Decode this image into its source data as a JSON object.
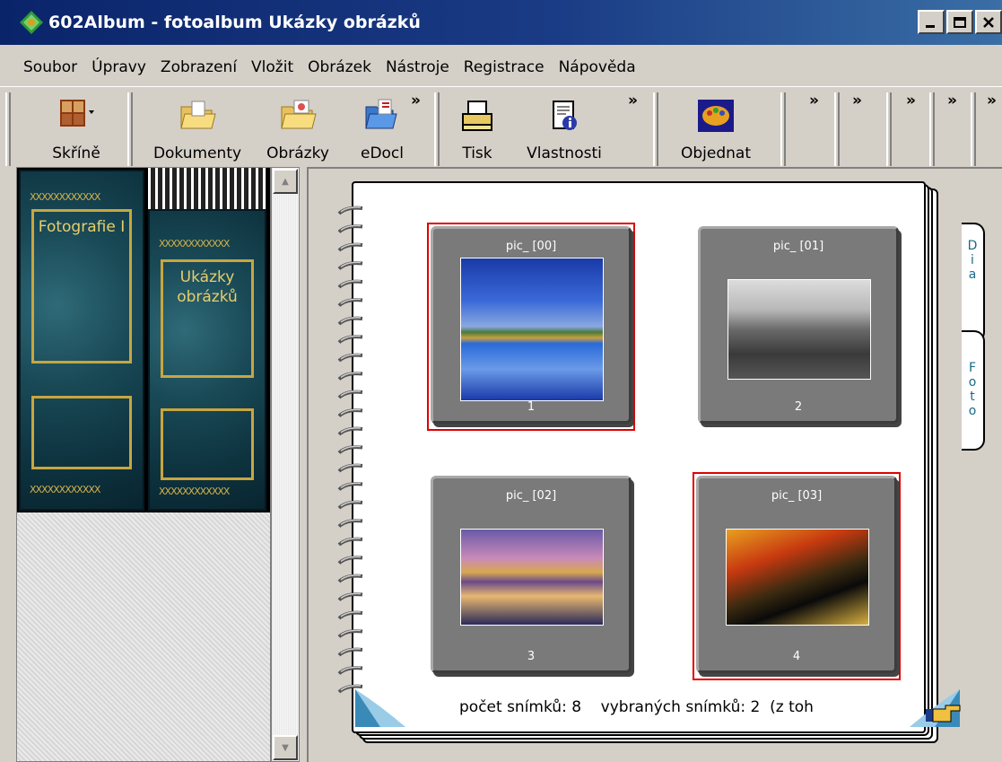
{
  "window": {
    "title": "602Album - fotoalbum Ukázky obrázků"
  },
  "menu": [
    "Soubor",
    "Úpravy",
    "Zobrazení",
    "Vložit",
    "Obrázek",
    "Nástroje",
    "Registrace",
    "Nápověda"
  ],
  "toolbar": {
    "skrine": "Skříně",
    "dokumenty": "Dokumenty",
    "obrazky": "Obrázky",
    "edoc": "eDocl",
    "tisk": "Tisk",
    "vlastnosti": "Vlastnosti",
    "objednat": "Objednat",
    "chevron": "»"
  },
  "shelf": {
    "book1": "Fotografie I",
    "book2": "Ukázky obrázků"
  },
  "tabs": {
    "dia": "Dia",
    "foto": "Foto"
  },
  "slides": [
    {
      "title": "pic_ [00]",
      "number": "1",
      "selected": true
    },
    {
      "title": "pic_ [01]",
      "number": "2",
      "selected": false
    },
    {
      "title": "pic_ [02]",
      "number": "3",
      "selected": false
    },
    {
      "title": "pic_ [03]",
      "number": "4",
      "selected": true
    }
  ],
  "status": {
    "count_label": "počet snímků: 8",
    "selected_label": "vybraných snímků: 2",
    "extra": "(z toh"
  },
  "colors": {
    "title_bar": "#0a246a",
    "selection": "#e00000",
    "tab_text": "#1a6a8a"
  }
}
